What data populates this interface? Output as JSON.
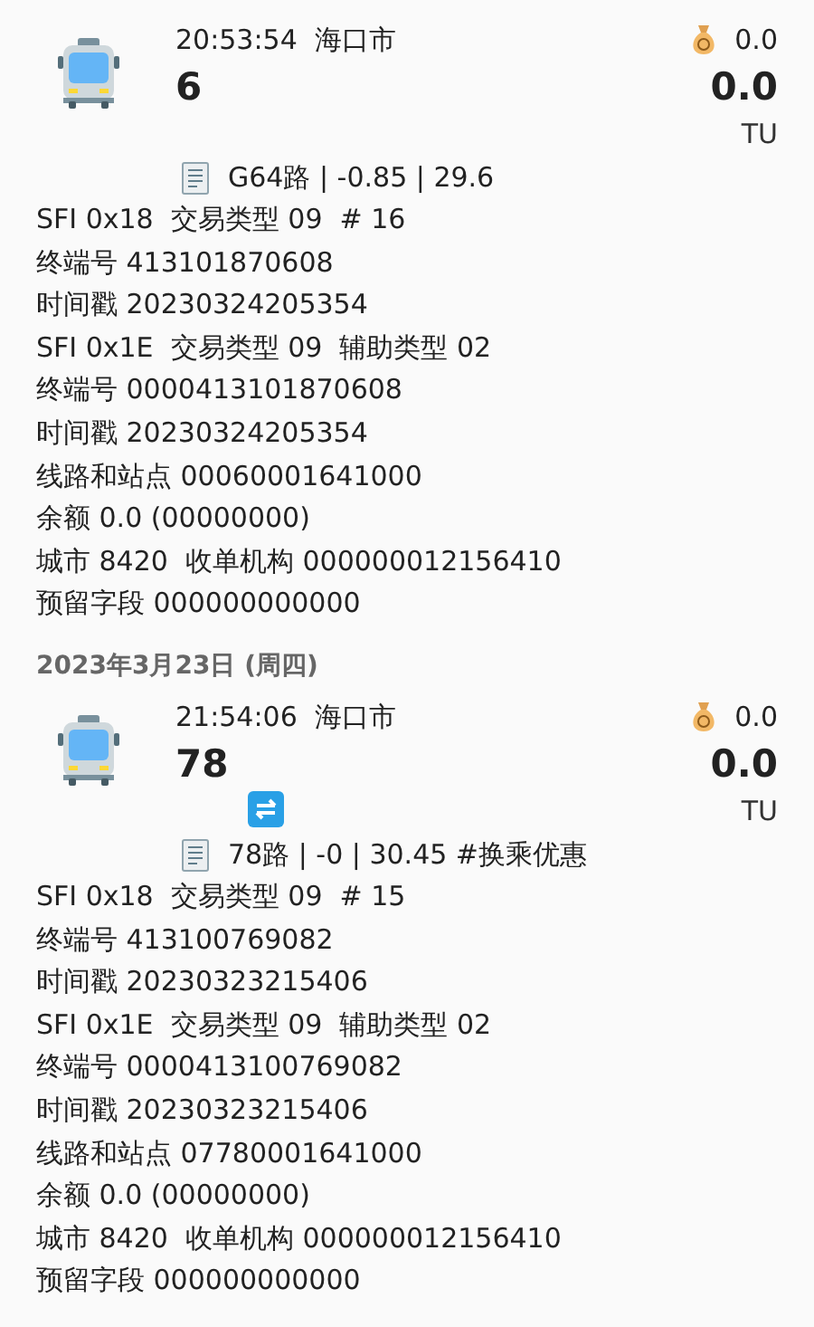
{
  "records": [
    {
      "time": "20:53:54",
      "city": "海口市",
      "route_no": "6",
      "balance": "0.0",
      "amount": "0.0",
      "unit": "TU",
      "transfer": false,
      "summary": "G64路 | -0.85 | 29.6",
      "details": [
        "SFI 0x18  交易类型 09  # 16",
        "终端号 413101870608",
        "时间戳 20230324205354",
        "SFI 0x1E  交易类型 09  辅助类型 02",
        "终端号 0000413101870608",
        "时间戳 20230324205354",
        "线路和站点 00060001641000",
        "余额 0.0 (00000000)",
        "城市 8420  收单机构 000000012156410",
        "预留字段 000000000000"
      ]
    },
    {
      "date_header": "2023年3月23日 (周四)",
      "time": "21:54:06",
      "city": "海口市",
      "route_no": "78",
      "balance": "0.0",
      "amount": "0.0",
      "unit": "TU",
      "transfer": true,
      "summary": "78路 | -0 | 30.45 #换乘优惠",
      "details": [
        "SFI 0x18  交易类型 09  # 15",
        "终端号 413100769082",
        "时间戳 20230323215406",
        "SFI 0x1E  交易类型 09  辅助类型 02",
        "终端号 0000413100769082",
        "时间戳 20230323215406",
        "线路和站点 07780001641000",
        "余额 0.0 (00000000)",
        "城市 8420  收单机构 000000012156410",
        "预留字段 000000000000"
      ]
    }
  ]
}
